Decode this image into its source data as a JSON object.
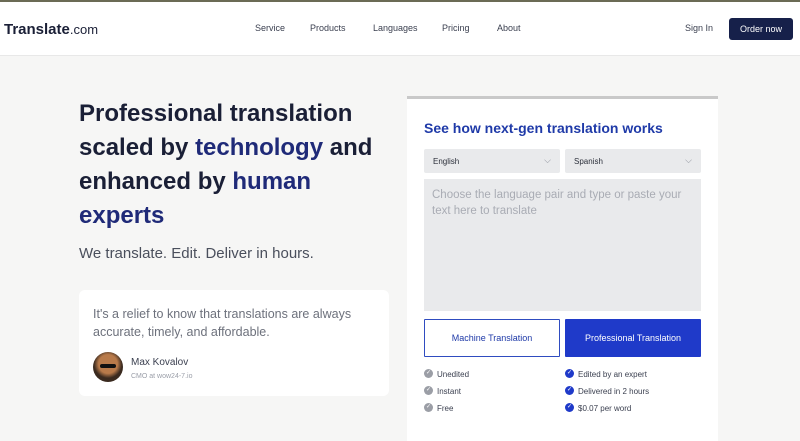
{
  "header": {
    "logo_brand": "Translate",
    "logo_domain": ".com",
    "nav": [
      "Service",
      "Products",
      "Languages",
      "Pricing",
      "About"
    ],
    "sign_in": "Sign In",
    "order_button": "Order now"
  },
  "hero": {
    "title_part1": "Professional translation scaled by ",
    "title_hl1": "technology",
    "title_part2": " and enhanced by ",
    "title_hl2": "human experts",
    "tagline": "We translate. Edit. Deliver in hours."
  },
  "testimonial": {
    "quote": "It's a relief to know that translations are always accurate, timely, and affordable.",
    "name": "Max Kovalov",
    "role": "CMO at wow24-7.io"
  },
  "translator": {
    "title": "See how next-gen translation works",
    "source_lang": "English",
    "target_lang": "Spanish",
    "placeholder": "Choose the language pair and type or paste your text here to translate",
    "machine_button": "Machine Translation",
    "pro_button": "Professional Translation",
    "machine_features": [
      "Unedited",
      "Instant",
      "Free"
    ],
    "pro_features": [
      "Edited by an expert",
      "Delivered in 2 hours",
      "$0.07 per word"
    ]
  },
  "colors": {
    "brand_dark": "#16204a",
    "accent_blue": "#1f3ac9",
    "highlight": "#1f2a78"
  }
}
